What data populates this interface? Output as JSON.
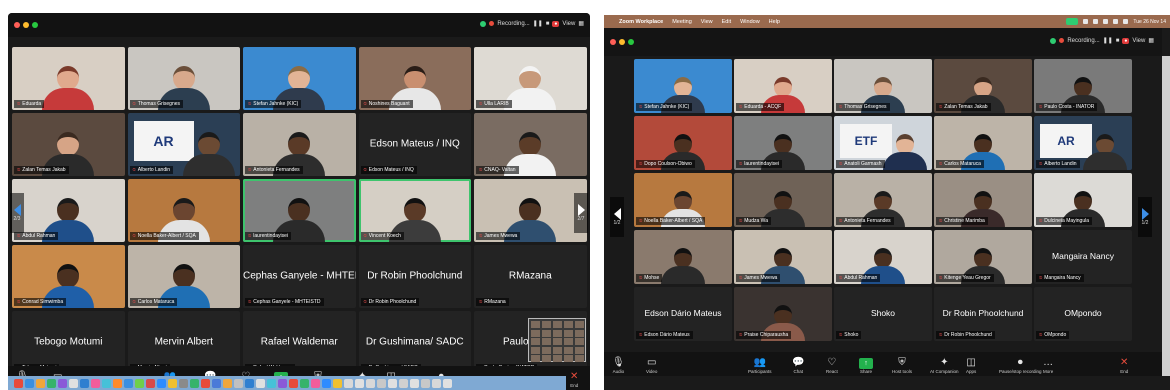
{
  "left": {
    "recording_label": "Recording...",
    "view_label": "View",
    "page_left": "2/3",
    "page_right": "2/7",
    "tiles": [
      {
        "name": "Eduarda",
        "video": true,
        "bg": "#d8cfc4",
        "skin": "#e0a98d",
        "shirt": "#c63a3a",
        "hair": "#7a3a2a"
      },
      {
        "name": "Thomas Grisegnes",
        "video": true,
        "bg": "#c9c6c1",
        "skin": "#d8a98c",
        "shirt": "#2c3e50",
        "hair": "#6b4f3a"
      },
      {
        "name": "Stefan Jahnke (KIC)",
        "video": true,
        "bg": "#3b8ad0",
        "skin": "#e2b496",
        "shirt": "#2f3b4d",
        "hair": "#8a6b45"
      },
      {
        "name": "Noshines Baguant",
        "video": true,
        "bg": "#8a6d5b",
        "skin": "#c98f70",
        "shirt": "#e7e7e7",
        "hair": "#2a1d17"
      },
      {
        "name": "Ulla LARIB",
        "video": true,
        "bg": "#dedad3",
        "skin": "#c7997a",
        "shirt": "#f2f2f2",
        "hair": "#f3f3f3"
      },
      {
        "name": "Zalan Temas Jakab",
        "video": true,
        "bg": "#5b4a3f",
        "skin": "#d6a486",
        "shirt": "#2a2a2a",
        "hair": "#3a2a20"
      },
      {
        "name": "Alberto Landin",
        "video": true,
        "bg": "#2b3f55",
        "logo": "AR",
        "skin": "#6b4a33",
        "shirt": "#2e2e2e",
        "hair": "#1a1a1a"
      },
      {
        "name": "Antonieta Fernandes",
        "video": true,
        "bg": "#b9b1a6",
        "skin": "#5a3a27",
        "shirt": "#2d2d2d",
        "hair": "#1a1a1a"
      },
      {
        "name": "Edson Mateus / INQ",
        "video": false,
        "bigname": "Edson Mateus / INQ"
      },
      {
        "name": "CNAQ- Valtan",
        "video": true,
        "bg": "#7a6c62",
        "skin": "#5b3c28",
        "shirt": "#f2f2f2",
        "hair": "#1a1a1a"
      },
      {
        "name": "Abdul Rahman",
        "video": true,
        "bg": "#d8d3cc",
        "skin": "#4a3020",
        "shirt": "#1f4f8a",
        "hair": "#1a1a1a"
      },
      {
        "name": "Noella Baker-Albert / SQA",
        "video": true,
        "bg": "#b7793f",
        "skin": "#6b4530",
        "shirt": "#e3e3e3",
        "hair": "#1a1a1a"
      },
      {
        "name": "laurentindayisei",
        "video": true,
        "bg": "#7e7f7f",
        "skin": "#4a3020",
        "shirt": "#2a2a2a",
        "hair": "#111",
        "active": true
      },
      {
        "name": "Vincent Koech",
        "video": true,
        "bg": "#d5cfc5",
        "skin": "#5a3a27",
        "shirt": "#3c3c3c",
        "hair": "#111",
        "active": true
      },
      {
        "name": "James Mwewa",
        "video": true,
        "bg": "#c9c0b3",
        "skin": "#4a3020",
        "shirt": "#2f4f6f",
        "hair": "#111"
      },
      {
        "name": "Conrad Simwimba",
        "video": true,
        "bg": "#c98a4a",
        "skin": "#4a3020",
        "shirt": "#1f5fa8",
        "hair": "#111"
      },
      {
        "name": "Carlos Mataruca",
        "video": true,
        "bg": "#bdb4a8",
        "skin": "#4a3020",
        "shirt": "#1f6fb4",
        "hair": "#111"
      },
      {
        "name": "Cephas Ganyele - MHTEISTD",
        "video": false,
        "bigname": "Cephas Ganyele - MHTEISTD"
      },
      {
        "name": "Dr Robin Phoolchund",
        "video": false,
        "bigname": "Dr Robin Phoolchund"
      },
      {
        "name": "RMazana",
        "video": false,
        "bigname": "RMazana"
      },
      {
        "name": "Tebogo Motumi",
        "video": false,
        "bigname": "Tebogo Motumi"
      },
      {
        "name": "Mervin Albert",
        "video": false,
        "bigname": "Mervin Albert"
      },
      {
        "name": "Rafael Waldemar",
        "video": false,
        "bigname": "Rafael Waldemar"
      },
      {
        "name": "Dr Gushimana/ SADC",
        "video": false,
        "bigname": "Dr Gushimana/ SADC"
      },
      {
        "name": "Paulo Costa - INATOR",
        "video": false,
        "bigname": "Paulo Costa"
      }
    ],
    "toolbar": [
      {
        "icon": "🎙",
        "label": "Audio",
        "name": "audio-button"
      },
      {
        "icon": "▭",
        "label": "Video",
        "name": "video-button"
      },
      {
        "icon": "👥",
        "label": "Participants",
        "name": "participants-button"
      },
      {
        "icon": "💬",
        "label": "Chat",
        "name": "chat-button"
      },
      {
        "icon": "♡",
        "label": "React",
        "name": "react-button"
      },
      {
        "icon": "↑",
        "label": "Share",
        "name": "share-button",
        "green": true
      },
      {
        "icon": "⛨",
        "label": "Host tools",
        "name": "host-tools-button"
      },
      {
        "icon": "✦",
        "label": "AI Companion",
        "name": "ai-companion-button"
      },
      {
        "icon": "◫",
        "label": "Apps",
        "name": "apps-button"
      },
      {
        "icon": "⏺",
        "label": "Pause/stop recording",
        "name": "recording-button"
      },
      {
        "icon": "…",
        "label": "More",
        "name": "more-button"
      },
      {
        "icon": "✕",
        "label": "End",
        "name": "end-button",
        "red": true
      }
    ]
  },
  "right": {
    "menubar": {
      "app": "Zoom Workplace",
      "items": [
        "Meeting",
        "View",
        "Edit",
        "Window",
        "Help"
      ],
      "clock": "Tue 26 Nov 14"
    },
    "recording_label": "Recording...",
    "view_label": "View",
    "page_left": "1/2",
    "page_right": "1/2",
    "tiles": [
      {
        "name": "Stefan Jahnke (KIC)",
        "video": true,
        "bg": "#3b8ad0",
        "skin": "#e2b496",
        "shirt": "#2f3b4d",
        "hair": "#8a6b45"
      },
      {
        "name": "Eduarda - ACQF",
        "video": true,
        "bg": "#d8cfc4",
        "skin": "#e0a98d",
        "shirt": "#c63a3a",
        "hair": "#7a3a2a"
      },
      {
        "name": "Thomas Grisegnes",
        "video": true,
        "bg": "#c9c6c1",
        "skin": "#d8a98c",
        "shirt": "#2c3e50",
        "hair": "#6b4f3a"
      },
      {
        "name": "Zalan Temas Jakab",
        "video": true,
        "bg": "#5b4a3f",
        "skin": "#d6a486",
        "shirt": "#2a2a2a",
        "hair": "#3a2a20"
      },
      {
        "name": "Paulo Costa - INATOR",
        "video": true,
        "bg": "#7a7a7a",
        "skin": "#4a3020",
        "shirt": "#2a2a2a",
        "hair": "#111"
      },
      {
        "name": "Dopo Coulson-Obiwo",
        "video": true,
        "bg": "#b34a3a",
        "skin": "#4a3020",
        "shirt": "#2a2a2a",
        "hair": "#111"
      },
      {
        "name": "laurentindayisei",
        "video": true,
        "bg": "#7e7f7f",
        "skin": "#4a3020",
        "shirt": "#2a2a2a",
        "hair": "#111"
      },
      {
        "name": "Anatoli Garmash",
        "video": true,
        "bg": "#cfd5db",
        "logo": "ETF",
        "skin": "#e2b496",
        "shirt": "#1f2f4f",
        "hair": "#5a4030"
      },
      {
        "name": "Carlos Mataruca",
        "video": true,
        "bg": "#bdb4a8",
        "skin": "#4a3020",
        "shirt": "#1f6fb4",
        "hair": "#111"
      },
      {
        "name": "Alberto Landin",
        "video": true,
        "bg": "#2b3f55",
        "logo": "AR",
        "skin": "#6b4a33",
        "shirt": "#2e2e2e",
        "hair": "#1a1a1a"
      },
      {
        "name": "Noella Baker-Albert / SQA",
        "video": true,
        "bg": "#b7793f",
        "skin": "#6b4530",
        "shirt": "#e3e3e3",
        "hair": "#1a1a1a"
      },
      {
        "name": "Mudza Wa",
        "video": true,
        "bg": "#6f6257",
        "skin": "#4a3020",
        "shirt": "#2d2d2d",
        "hair": "#111"
      },
      {
        "name": "Antonieta Fernandes",
        "video": true,
        "bg": "#b9b1a6",
        "skin": "#5a3a27",
        "shirt": "#2d2d2d",
        "hair": "#1a1a1a"
      },
      {
        "name": "Christine Marimba",
        "video": true,
        "bg": "#9a8f84",
        "skin": "#4a3020",
        "shirt": "#3a2a2a",
        "hair": "#111"
      },
      {
        "name": "Dulcineia Mayingula",
        "video": true,
        "bg": "#dcdad6",
        "skin": "#4a3020",
        "shirt": "#2a2a2a",
        "hair": "#111"
      },
      {
        "name": "Mohse",
        "video": true,
        "bg": "#8a7a6d",
        "skin": "#4a3020",
        "shirt": "#2a2a2a",
        "hair": "#111"
      },
      {
        "name": "James Mwewa",
        "video": true,
        "bg": "#c9c0b3",
        "skin": "#4a3020",
        "shirt": "#2f4f6f",
        "hair": "#111"
      },
      {
        "name": "Abdul Rahman",
        "video": true,
        "bg": "#d8d3cc",
        "skin": "#4a3020",
        "shirt": "#1f4f8a",
        "hair": "#1a1a1a"
      },
      {
        "name": "Kitenge Yeau Gregor",
        "video": true,
        "bg": "#b0a89e",
        "skin": "#4a3020",
        "shirt": "#2a2a2a",
        "hair": "#111"
      },
      {
        "name": "Mangaira Nancy",
        "video": false,
        "bigname": "Mangaira Nancy"
      },
      {
        "name": "Edson Dário Mateus",
        "video": false,
        "bigname": "Edson Dário Mateus"
      },
      {
        "name": "Praise Chiparausha",
        "video": true,
        "bg": "#3a3330",
        "skin": "#4a3020",
        "shirt": "#8a5a4a",
        "hair": "#111"
      },
      {
        "name": "Shoko",
        "video": false,
        "bigname": "Shoko"
      },
      {
        "name": "Dr Robin Phoolchund",
        "video": false,
        "bigname": "Dr Robin Phoolchund"
      },
      {
        "name": "OMpondo",
        "video": false,
        "bigname": "OMpondo"
      }
    ]
  },
  "colors": {
    "accent": "#2d8cff",
    "share_green": "#23b14d",
    "end_red": "#e74c3c",
    "active_speaker": "#3ec46d"
  }
}
